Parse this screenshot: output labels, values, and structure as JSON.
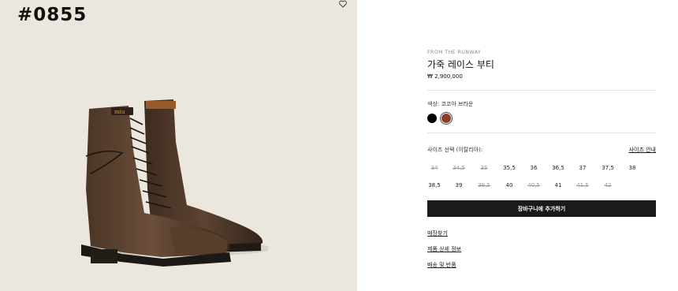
{
  "gallery": {
    "product_number": "#0855",
    "wishlist_icon": "heart-outline-icon",
    "background_color": "#ebe7df"
  },
  "product": {
    "eyebrow": "FROM THE RUNWAY",
    "title": "가죽 레이스 부티",
    "price": "₩ 2,900,000",
    "color_label": "색상: 코코아 브라운",
    "colors": [
      {
        "name": "black",
        "hex": "#000000",
        "selected": false
      },
      {
        "name": "cocoa-brown",
        "hex": "#8b3e2a",
        "selected": true
      }
    ],
    "size_label": "사이즈 선택 (이탈리아):",
    "size_guide": "사이즈 안내",
    "sizes": [
      {
        "label": "34",
        "available": false
      },
      {
        "label": "34,5",
        "available": false
      },
      {
        "label": "35",
        "available": false
      },
      {
        "label": "35,5",
        "available": true
      },
      {
        "label": "36",
        "available": true
      },
      {
        "label": "36,5",
        "available": true
      },
      {
        "label": "37",
        "available": true
      },
      {
        "label": "37,5",
        "available": true
      },
      {
        "label": "38",
        "available": true
      },
      {
        "label": "38,5",
        "available": true
      },
      {
        "label": "39",
        "available": true
      },
      {
        "label": "39,5",
        "available": false
      },
      {
        "label": "40",
        "available": true
      },
      {
        "label": "40,5",
        "available": false
      },
      {
        "label": "41",
        "available": true
      },
      {
        "label": "41,5",
        "available": false
      },
      {
        "label": "42",
        "available": false
      }
    ],
    "add_to_cart": "장바구니에 추가하기",
    "links": [
      "매장찾기",
      "제품 상세 정보",
      "배송 및 반품"
    ]
  }
}
